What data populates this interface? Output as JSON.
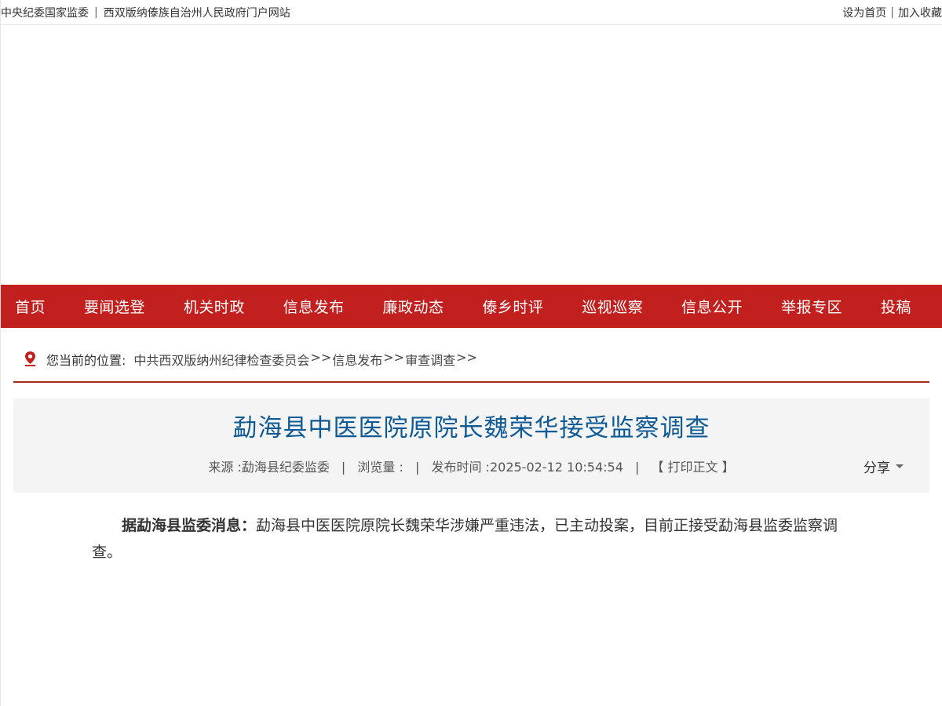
{
  "topbar": {
    "left_link_1": "中央纪委国家监委",
    "divider": "|",
    "left_link_2": "西双版纳傣族自治州人民政府门户网站",
    "right_link_1": "设为首页",
    "right_divider": "|",
    "right_link_2": "加入收藏"
  },
  "nav": {
    "items": [
      {
        "label": "首页"
      },
      {
        "label": "要闻选登"
      },
      {
        "label": "机关时政"
      },
      {
        "label": "信息发布"
      },
      {
        "label": "廉政动态"
      },
      {
        "label": "傣乡时评"
      },
      {
        "label": "巡视巡察"
      },
      {
        "label": "信息公开"
      },
      {
        "label": "举报专区"
      },
      {
        "label": "投稿"
      }
    ],
    "background_color": "#c21f1f"
  },
  "breadcrumb": {
    "label": "您当前的位置:",
    "items": [
      "中共西双版纳州纪律检查委员会",
      "信息发布",
      "审查调查"
    ],
    "separator": ">>",
    "icon": "location-pin-icon"
  },
  "article": {
    "title": "勐海县中医医院原院长魏荣华接受监察调查",
    "source_label": "来源 :",
    "source": "勐海县纪委监委",
    "views_label": "浏览量 :",
    "views": "",
    "publish_label": "发布时间 :",
    "publish_time": "2025-02-12 10:54:54",
    "print_label": "【 打印正文 】",
    "meta_divider": "|",
    "share_label": "分享",
    "lead_bold": "据勐海县监委消息：",
    "body": "勐海县中医医院原院长魏荣华涉嫌严重违法，已主动投案，目前正接受勐海县监委监察调查。",
    "title_color": "#0d5a95"
  }
}
